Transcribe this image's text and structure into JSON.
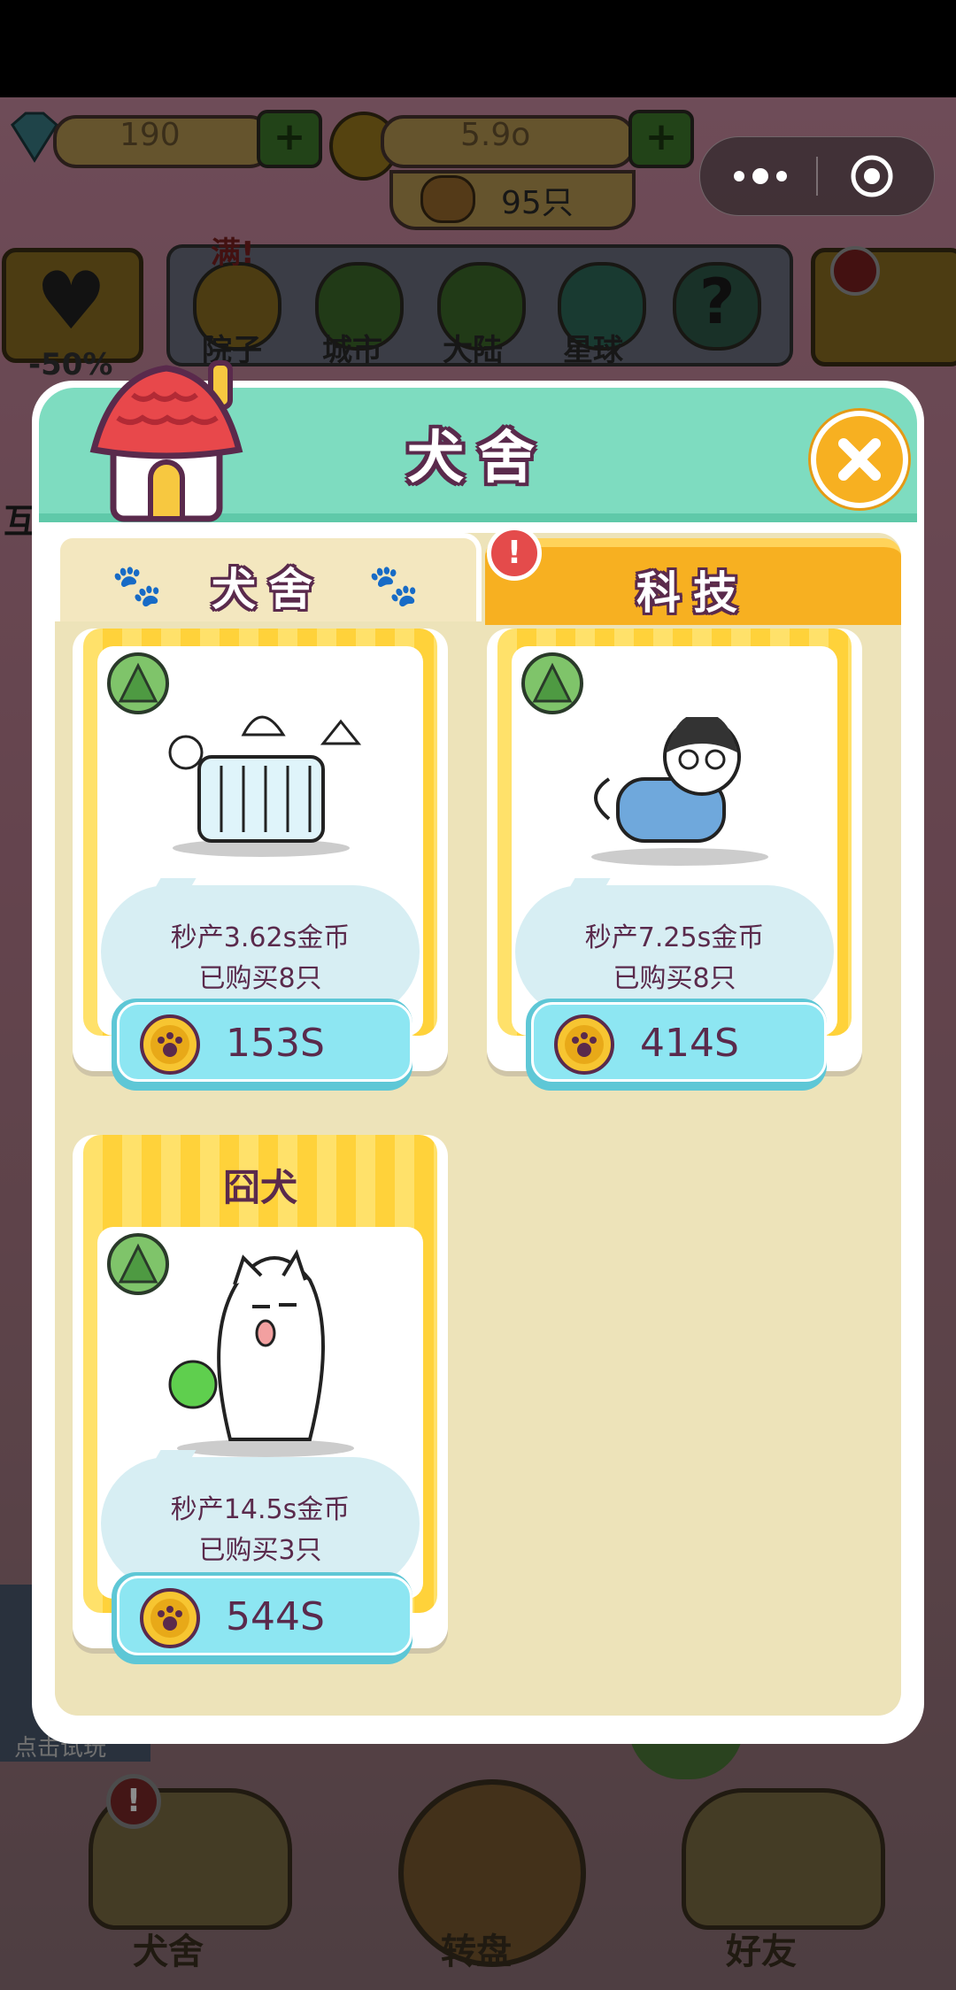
{
  "hud": {
    "diamonds": "190",
    "coins": "5.9o",
    "dog_count": "95只",
    "discount": "-50%",
    "categories": [
      {
        "label": "院子",
        "badge": "满!"
      },
      {
        "label": "城市"
      },
      {
        "label": "大陆"
      },
      {
        "label": "星球"
      },
      {
        "label": "?"
      }
    ],
    "side_label": "互",
    "promo_label": "点击试玩"
  },
  "capsule": {
    "menu_icon": "more-dots-icon",
    "close_icon": "record-circle-icon"
  },
  "modal": {
    "title": "犬舍",
    "tabs": [
      {
        "label": "犬舍",
        "active": true
      },
      {
        "label": "科技",
        "active": false,
        "badge": "!"
      }
    ],
    "items": [
      {
        "header": "",
        "stat": "秒产3.62s金币",
        "bought": "已购买8只",
        "price": "153S"
      },
      {
        "header": "",
        "stat": "秒产7.25s金币",
        "bought": "已购买8只",
        "price": "414S"
      },
      {
        "header": "囧犬",
        "stat": "秒产14.5s金币",
        "bought": "已购买3只",
        "price": "544S"
      }
    ]
  },
  "bottom_nav": [
    {
      "label": "犬舍",
      "badge": "!"
    },
    {
      "label": "转盘"
    },
    {
      "label": "好友"
    }
  ],
  "colors": {
    "accent": "#7edcc0",
    "tab_active": "#f7b021",
    "plum": "#5a2a4c",
    "price_button": "#8de6f2"
  }
}
